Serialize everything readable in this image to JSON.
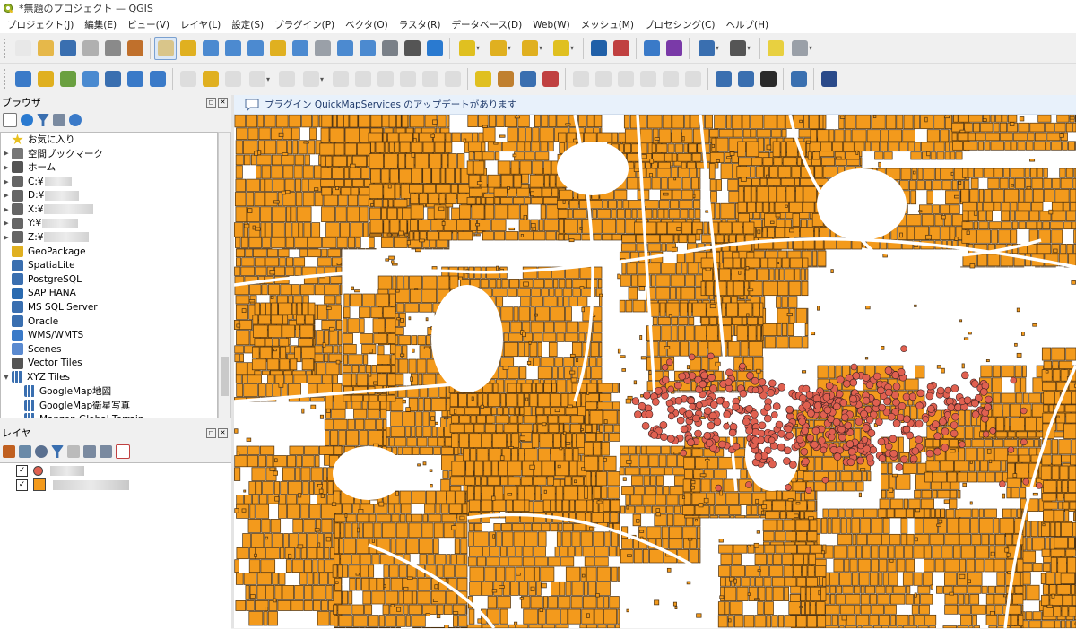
{
  "window": {
    "title": "*無題のプロジェクト — QGIS"
  },
  "menu": [
    "プロジェクト(J)",
    "編集(E)",
    "ビュー(V)",
    "レイヤ(L)",
    "設定(S)",
    "プラグイン(P)",
    "ベクタ(O)",
    "ラスタ(R)",
    "データベース(D)",
    "Web(W)",
    "メッシュ(M)",
    "プロセシング(C)",
    "ヘルプ(H)"
  ],
  "toolbar1": [
    {
      "icon": "new-project-icon",
      "color": "#e8e8e8"
    },
    {
      "icon": "open-project-icon",
      "color": "#e6b84a"
    },
    {
      "icon": "save-project-icon",
      "color": "#3a6fb0"
    },
    {
      "icon": "new-print-layout-icon",
      "color": "#b0b0b0"
    },
    {
      "icon": "layout-manager-icon",
      "color": "#8a8a8a"
    },
    {
      "icon": "style-manager-icon",
      "color": "#c0702c"
    },
    {
      "icon": "pan-icon",
      "color": "#d9c58a",
      "active": true
    },
    {
      "icon": "pan-to-selection-icon",
      "color": "#e0b020"
    },
    {
      "icon": "zoom-in-icon",
      "color": "#4c8ad0"
    },
    {
      "icon": "zoom-out-icon",
      "color": "#4c8ad0"
    },
    {
      "icon": "zoom-full-icon",
      "color": "#4c8ad0"
    },
    {
      "icon": "zoom-to-selection-icon",
      "color": "#e0b020"
    },
    {
      "icon": "zoom-to-layer-icon",
      "color": "#4c8ad0"
    },
    {
      "icon": "zoom-native-icon",
      "color": "#9aa0a8"
    },
    {
      "icon": "zoom-last-icon",
      "color": "#4c8ad0"
    },
    {
      "icon": "zoom-next-icon",
      "color": "#4c8ad0"
    },
    {
      "icon": "new-map-view-icon",
      "color": "#7a8088"
    },
    {
      "icon": "temporal-controller-icon",
      "color": "#555"
    },
    {
      "icon": "refresh-icon",
      "color": "#2a7ad0"
    },
    {
      "icon": "select-features-icon",
      "color": "#e0c020",
      "dd": true
    },
    {
      "icon": "select-by-attribute-icon",
      "color": "#e0b020",
      "dd": true
    },
    {
      "icon": "deselect-icon",
      "color": "#e0b020",
      "dd": true
    },
    {
      "icon": "select-location-icon",
      "color": "#e0c020",
      "dd": true
    },
    {
      "icon": "identify-icon",
      "color": "#2060a8"
    },
    {
      "icon": "attribute-table-icon",
      "color": "#c04040"
    },
    {
      "icon": "toolbox-icon",
      "color": "#3a7ac8"
    },
    {
      "icon": "statistics-icon",
      "color": "#7a3aa8"
    },
    {
      "icon": "open-table-icon",
      "color": "#3a6fb0",
      "dd": true
    },
    {
      "icon": "measure-icon",
      "color": "#555",
      "dd": true
    },
    {
      "icon": "map-tips-icon",
      "color": "#e8d040"
    },
    {
      "icon": "search-locator-icon",
      "color": "#9aa0a8",
      "dd": true
    }
  ],
  "toolbar2": [
    {
      "icon": "data-source-manager-icon",
      "color": "#3a7ac8"
    },
    {
      "icon": "new-geopackage-icon",
      "color": "#e0b020"
    },
    {
      "icon": "new-shapefile-icon",
      "color": "#6aa040"
    },
    {
      "icon": "digitize-icon",
      "color": "#4a8ad0"
    },
    {
      "icon": "gps-icon",
      "color": "#3a6fb0"
    },
    {
      "icon": "add-raster-icon",
      "color": "#3a7ac8"
    },
    {
      "icon": "add-vector-icon",
      "color": "#3a7ac8"
    },
    {
      "icon": "toggle-editing-icon",
      "color": "#bbb",
      "dim": true
    },
    {
      "icon": "pencil-icon",
      "color": "#e0b020"
    },
    {
      "icon": "save-edits-icon",
      "color": "#bbb",
      "dim": true
    },
    {
      "icon": "add-line-icon",
      "color": "#bbb",
      "dim": true,
      "dd": true
    },
    {
      "icon": "vertex-tool-icon",
      "color": "#bbb",
      "dim": true
    },
    {
      "icon": "modify-attribute-icon",
      "color": "#bbb",
      "dim": true,
      "dd": true
    },
    {
      "icon": "delete-selected-icon",
      "color": "#bbb",
      "dim": true
    },
    {
      "icon": "cut-features-icon",
      "color": "#bbb",
      "dim": true
    },
    {
      "icon": "copy-features-icon",
      "color": "#bbb",
      "dim": true
    },
    {
      "icon": "paste-features-icon",
      "color": "#bbb",
      "dim": true
    },
    {
      "icon": "undo-icon",
      "color": "#bbb",
      "dim": true
    },
    {
      "icon": "redo-icon",
      "color": "#bbb",
      "dim": true
    },
    {
      "icon": "label-tool-icon",
      "color": "#e0c020"
    },
    {
      "icon": "label-layer-icon",
      "color": "#c08030"
    },
    {
      "icon": "pin-label-icon",
      "color": "#3a6fb0"
    },
    {
      "icon": "highlight-label-icon",
      "color": "#c04040"
    },
    {
      "icon": "move-label-icon",
      "color": "#bbb",
      "dim": true
    },
    {
      "icon": "rotate-label-icon",
      "color": "#bbb",
      "dim": true
    },
    {
      "icon": "change-label-icon",
      "color": "#bbb",
      "dim": true
    },
    {
      "icon": "show-hide-label-icon",
      "color": "#bbb",
      "dim": true
    },
    {
      "icon": "label-properties-icon",
      "color": "#bbb",
      "dim": true
    },
    {
      "icon": "diagram-icon",
      "color": "#bbb",
      "dim": true
    },
    {
      "icon": "quickmap-add-icon",
      "color": "#3a6fb0"
    },
    {
      "icon": "quickmap-search-icon",
      "color": "#3a6fb0"
    },
    {
      "icon": "geoweb-icon",
      "color": "#2a2a2a"
    },
    {
      "icon": "python-console-icon",
      "color": "#3a70b0"
    },
    {
      "icon": "help-icon",
      "color": "#2a4a8a"
    }
  ],
  "browser": {
    "title": "ブラウザ",
    "items": [
      {
        "label": "お気に入り",
        "icon": "star-icon",
        "arrow": "",
        "color": "#e8c020"
      },
      {
        "label": "空間ブックマーク",
        "icon": "bookmark-icon",
        "arrow": "▶",
        "color": "#777"
      },
      {
        "label": "ホーム",
        "icon": "home-icon",
        "arrow": "▶",
        "color": "#555"
      },
      {
        "label": "C:¥",
        "icon": "drive-icon",
        "arrow": "▶",
        "color": "#666",
        "blur": 30
      },
      {
        "label": "D:¥",
        "icon": "drive-icon",
        "arrow": "▶",
        "color": "#666",
        "blur": 38
      },
      {
        "label": "X:¥",
        "icon": "drive-icon",
        "arrow": "▶",
        "color": "#666",
        "blur": 55
      },
      {
        "label": "Y:¥",
        "icon": "drive-icon",
        "arrow": "▶",
        "color": "#666",
        "blur": 40
      },
      {
        "label": "Z:¥",
        "icon": "drive-icon",
        "arrow": "▶",
        "color": "#666",
        "blur": 50
      },
      {
        "label": "GeoPackage",
        "icon": "geopackage-icon",
        "arrow": "",
        "color": "#e0b020"
      },
      {
        "label": "SpatiaLite",
        "icon": "spatialite-icon",
        "arrow": "",
        "color": "#3a6fb0"
      },
      {
        "label": "PostgreSQL",
        "icon": "postgresql-icon",
        "arrow": "",
        "color": "#3a6fb0"
      },
      {
        "label": "SAP HANA",
        "icon": "sap-hana-icon",
        "arrow": "",
        "color": "#2a6ab0"
      },
      {
        "label": "MS SQL Server",
        "icon": "mssql-icon",
        "arrow": "",
        "color": "#3a6fb0"
      },
      {
        "label": "Oracle",
        "icon": "oracle-icon",
        "arrow": "",
        "color": "#3a6fb0"
      },
      {
        "label": "WMS/WMTS",
        "icon": "wms-icon",
        "arrow": "",
        "color": "#3a7ac8"
      },
      {
        "label": "Scenes",
        "icon": "scenes-icon",
        "arrow": "",
        "color": "#5a8ad0"
      },
      {
        "label": "Vector Tiles",
        "icon": "vector-tiles-icon",
        "arrow": "",
        "color": "#555"
      },
      {
        "label": "XYZ Tiles",
        "icon": "xyz-tiles-icon",
        "arrow": "▼",
        "color": "#3a6fb0"
      },
      {
        "label": "GoogleMap地図",
        "icon": "xyz-tiles-icon",
        "arrow": "",
        "color": "#3a6fb0",
        "indent": true
      },
      {
        "label": "GoogleMap衛星写真",
        "icon": "xyz-tiles-icon",
        "arrow": "",
        "color": "#3a6fb0",
        "indent": true
      },
      {
        "label": "Mapzen Global Terrain",
        "icon": "xyz-tiles-icon",
        "arrow": "",
        "color": "#3a6fb0",
        "indent": true
      }
    ]
  },
  "layers": {
    "title": "レイヤ",
    "items": [
      {
        "checked": "✓",
        "symbol": "point",
        "color": "#e06050",
        "blur": 38
      },
      {
        "checked": "✓",
        "symbol": "polygon",
        "color": "#f39a1c",
        "blur": 85
      }
    ]
  },
  "message": "プラグイン QuickMapServices のアップデートがあります",
  "map": {
    "polygon_fill": "#f39a1c",
    "polygon_stroke": "#4a3010",
    "point_fill": "#e06050"
  }
}
